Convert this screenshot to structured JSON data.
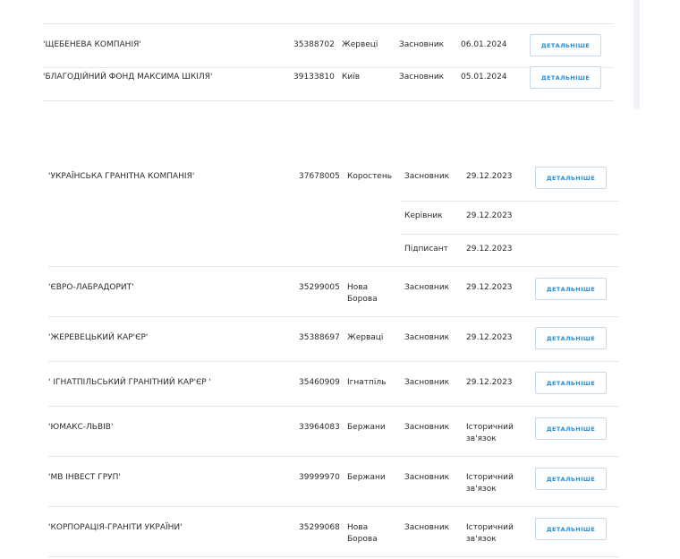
{
  "button_label": "ДЕТАЛЬНІШЕ",
  "top_rows": [
    {
      "name": "'ЩЕБЕНЕВА КОМПАНІЯ'",
      "code": "35388702",
      "city": "Жервеці",
      "role": "Засновник",
      "date": "06.01.2024"
    },
    {
      "name": "'БЛАГОДІЙНИЙ ФОНД МАКСИМА ШКІЛЯ'",
      "code": "39133810",
      "city": "Київ",
      "role": "Засновник",
      "date": "05.01.2024"
    }
  ],
  "bottom_rows": [
    {
      "name": "'УКРАЇНСЬКА ГРАНІТНА КОМПАНІЯ'",
      "code": "37678005",
      "city": "Коростень",
      "role": "Засновник",
      "date": "29.12.2023",
      "sub_rows": [
        {
          "role": "Керівник",
          "date": "29.12.2023"
        },
        {
          "role": "Підписант",
          "date": "29.12.2023"
        }
      ]
    },
    {
      "name": "'ЄВРО-ЛАБРАДОРИТ'",
      "code": "35299005",
      "city": "Нова Борова",
      "role": "Засновник",
      "date": "29.12.2023"
    },
    {
      "name": "'ЖЕРЕВЕЦЬКИЙ КАР'ЄР'",
      "code": "35388697",
      "city": "Жерваці",
      "role": "Засновник",
      "date": "29.12.2023"
    },
    {
      "name": "' ІГНАТПІЛЬСЬКИЙ ГРАНІТНИЙ КАР'ЄР '",
      "code": "35460909",
      "city": "Ігнатпіль",
      "role": "Засновник",
      "date": "29.12.2023"
    },
    {
      "name": "'ЮМАКС-ЛЬВІВ'",
      "code": "33964083",
      "city": "Бержани",
      "role": "Засновник",
      "date": "Історичний зв'язок"
    },
    {
      "name": "'МВ ІНВЕСТ ГРУП'",
      "code": "39999970",
      "city": "Бержани",
      "role": "Засновник",
      "date": "Історичний зв'язок"
    },
    {
      "name": "'КОРПОРАЦІЯ-ГРАНІТИ УКРАЇНИ'",
      "code": "35299068",
      "city": "Нова Борова",
      "role": "Засновник",
      "date": "Історичний зв'язок"
    }
  ]
}
